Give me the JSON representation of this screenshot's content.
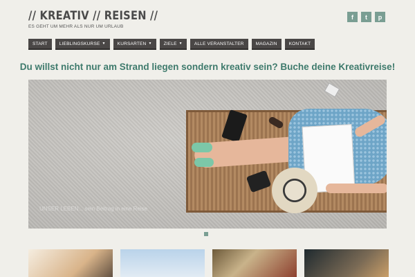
{
  "site": {
    "title": "// KREATIV // REISEN //",
    "tagline": "ES GEHT UM MEHR ALS NUR UM URLAUB"
  },
  "social": [
    {
      "icon": "facebook-icon",
      "glyph": "f"
    },
    {
      "icon": "twitter-icon",
      "glyph": "t"
    },
    {
      "icon": "pinterest-icon",
      "glyph": "p"
    }
  ],
  "nav": {
    "start": "START",
    "lieblingskurse": "LIEBLINGSKURSE",
    "kursarten": "KURSARTEN",
    "ziele": "ZIELE",
    "veranstalter": "ALLE VERANSTALTER",
    "magazin": "MAGAZIN",
    "kontakt": "KONTAKT"
  },
  "headline": "Du willst nicht nur am Strand liegen sondern kreativ sein? Buche deine Kreativreise!",
  "hero": {
    "caption": "UNSER LEBEN... sein Beitrag in eine Reise"
  },
  "colors": {
    "accent": "#7a9e93",
    "headline": "#3e7a6c",
    "nav_bg": "#4a4746",
    "page_bg": "#f0efea"
  }
}
